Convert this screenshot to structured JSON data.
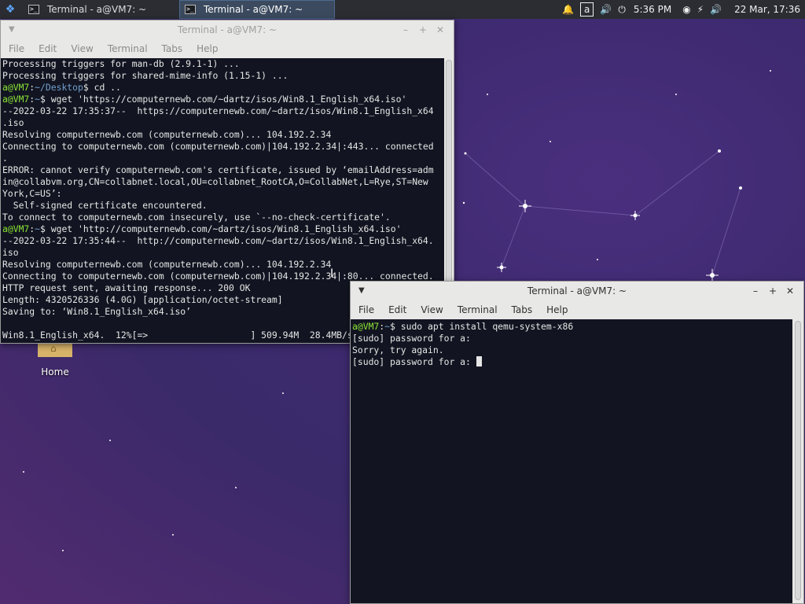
{
  "panel": {
    "tasks": [
      {
        "label": "Terminal - a@VM7: ~"
      },
      {
        "label": "Terminal - a@VM7: ~"
      }
    ],
    "keyboard_layout": "a",
    "clock": "5:36 PM",
    "date": "22 Mar, 17:36",
    "icons": [
      "whisker-menu-icon",
      "bell-icon",
      "volume-icon",
      "power-icon",
      "wifi-icon",
      "battery-icon",
      "volume-icon"
    ]
  },
  "desktop": {
    "home_label": "Home"
  },
  "terminal_back": {
    "title": "Terminal - a@VM7: ~",
    "menu": [
      "File",
      "Edit",
      "View",
      "Terminal",
      "Tabs",
      "Help"
    ],
    "lines": [
      {
        "text": "Processing triggers for man-db (2.9.1-1) ..."
      },
      {
        "text": "Processing triggers for shared-mime-info (1.15-1) ..."
      },
      {
        "user": "a@VM7",
        "path": "~/Desktop",
        "text": "$ cd .."
      },
      {
        "user": "a@VM7",
        "path": "~",
        "text": "$ wget 'https://computernewb.com/~dartz/isos/Win8.1_English_x64.iso'"
      },
      {
        "text": "--2022-03-22 17:35:37--  https://computernewb.com/~dartz/isos/Win8.1_English_x64"
      },
      {
        "text": ".iso"
      },
      {
        "text": "Resolving computernewb.com (computernewb.com)... 104.192.2.34"
      },
      {
        "text": "Connecting to computernewb.com (computernewb.com)|104.192.2.34|:443... connected"
      },
      {
        "text": "."
      },
      {
        "text": "ERROR: cannot verify computernewb.com's certificate, issued by ‘emailAddress=adm"
      },
      {
        "text": "in@collabvm.org,CN=collabnet.local,OU=collabnet_RootCA,O=CollabNet,L=Rye,ST=New"
      },
      {
        "text": "York,C=US’:"
      },
      {
        "text": "  Self-signed certificate encountered."
      },
      {
        "text": "To connect to computernewb.com insecurely, use `--no-check-certificate'."
      },
      {
        "user": "a@VM7",
        "path": "~",
        "text": "$ wget 'http://computernewb.com/~dartz/isos/Win8.1_English_x64.iso'"
      },
      {
        "text": "--2022-03-22 17:35:44--  http://computernewb.com/~dartz/isos/Win8.1_English_x64."
      },
      {
        "text": "iso"
      },
      {
        "text": "Resolving computernewb.com (computernewb.com)... 104.192.2.34"
      },
      {
        "text": "Connecting to computernewb.com (computernewb.com)|104.192.2.34|:80... connected."
      },
      {
        "text": "HTTP request sent, awaiting response... 200 OK"
      },
      {
        "text": "Length: 4320526336 (4.0G) [application/octet-stream]"
      },
      {
        "text": "Saving to: ‘Win8.1_English_x64.iso’"
      },
      {
        "text": ""
      },
      {
        "text": "Win8.1_English_x64.  12%[=>                   ] 509.94M  28.4MB/s"
      }
    ]
  },
  "terminal_front": {
    "title": "Terminal - a@VM7: ~",
    "menu": [
      "File",
      "Edit",
      "View",
      "Terminal",
      "Tabs",
      "Help"
    ],
    "lines": [
      {
        "user": "a@VM7",
        "path": "~",
        "text": "$ sudo apt install qemu-system-x86"
      },
      {
        "text": "[sudo] password for a:"
      },
      {
        "text": "Sorry, try again."
      },
      {
        "text": "[sudo] password for a: "
      }
    ]
  }
}
